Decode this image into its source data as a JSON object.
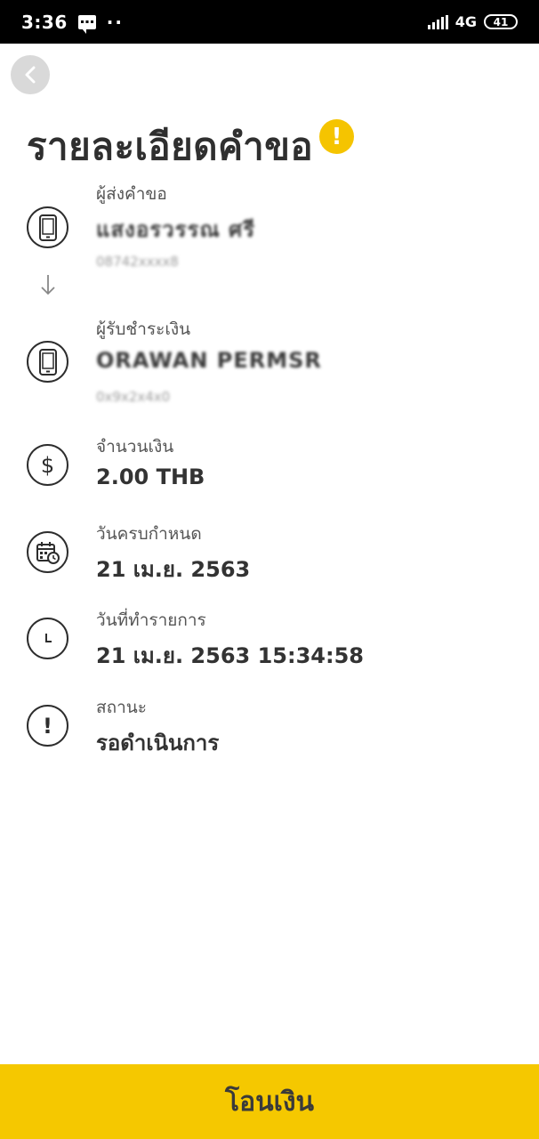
{
  "status_bar": {
    "time": "3:36",
    "more": "··",
    "network": "4G",
    "battery": "41"
  },
  "header": {
    "title": "รายละเอียดคำขอ",
    "alert_symbol": "!"
  },
  "requester": {
    "label": "ผู้ส่งคำขอ",
    "name": "แสงอรวรรณ ศรี",
    "sub": "08742xxxx8"
  },
  "payer": {
    "label": "ผู้รับชำระเงิน",
    "name": "ORAWAN PERMSR",
    "sub": "0x9x2x4x0"
  },
  "amount": {
    "label": "จำนวนเงิน",
    "value": "2.00 THB"
  },
  "due_date": {
    "label": "วันครบกำหนด",
    "value": "21 เม.ย. 2563"
  },
  "transaction_date": {
    "label": "วันที่ทำรายการ",
    "value": "21 เม.ย. 2563 15:34:58"
  },
  "status": {
    "label": "สถานะ",
    "value": "รอดำเนินการ"
  },
  "footer": {
    "transfer_label": "โอนเงิน"
  },
  "colors": {
    "accent": "#f5c800",
    "warning": "#f5c400",
    "text": "#333333"
  }
}
